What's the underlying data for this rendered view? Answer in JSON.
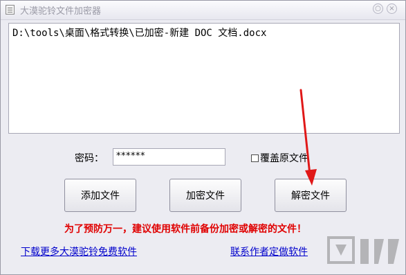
{
  "window": {
    "title": "大漠驼铃文件加密器",
    "minimize": "○",
    "close": "×"
  },
  "file_list": [
    "D:\\tools\\桌面\\格式转换\\已加密-新建 DOC 文档.docx"
  ],
  "password": {
    "label": "密码：",
    "value": "******"
  },
  "overwrite": {
    "label": "覆盖原文件",
    "checked": false
  },
  "buttons": {
    "add": "添加文件",
    "encrypt": "加密文件",
    "decrypt": "解密文件"
  },
  "warning": "为了预防万一，建议使用软件前备份加密或解密的文件！",
  "links": {
    "download": "下载更多大漠驼铃免费软件",
    "contact": "联系作者定做软件"
  },
  "colors": {
    "warning": "#e00000",
    "link": "#0000cc",
    "annotation_arrow": "#e01818"
  },
  "icons": [
    "app-document-icon",
    "minimize-icon",
    "close-icon",
    "annotation-arrow",
    "watermark-logo"
  ]
}
